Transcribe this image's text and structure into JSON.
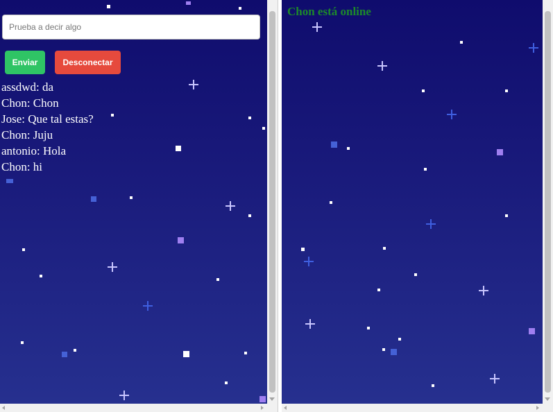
{
  "chat": {
    "input_placeholder": "Prueba a decir algo",
    "send_label": "Enviar",
    "disconnect_label": "Desconectar",
    "messages": [
      "assdwd: da",
      "Chon: Chon",
      "Jose: Que tal estas?",
      "Chon: Juju",
      "antonio: Hola",
      "Chon: hi"
    ]
  },
  "presence": {
    "status_text": "Chon está online"
  },
  "colors": {
    "send_button": "#2fc465",
    "disconnect_button": "#e64a3d",
    "online_text": "#1c8a2a",
    "background_top": "#0f0c6d",
    "background_bottom": "#26308f"
  }
}
